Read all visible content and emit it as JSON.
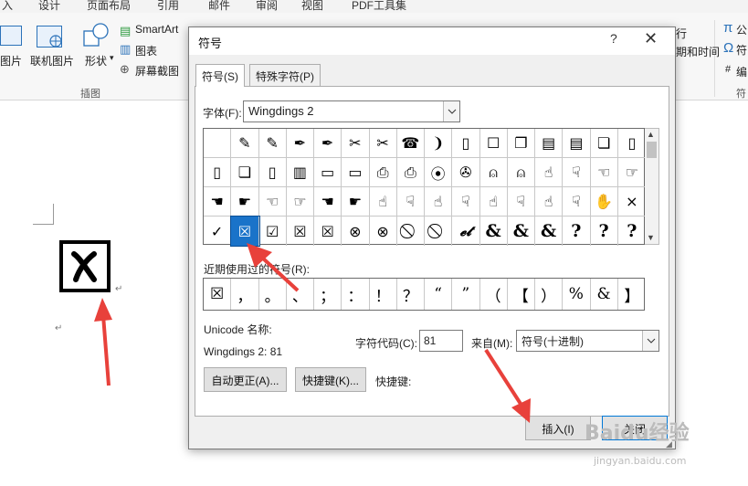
{
  "ribbon": {
    "tabs": [
      "入",
      "设计",
      "页面布局",
      "引用",
      "邮件",
      "审阅",
      "视图",
      "PDF工具集"
    ],
    "buttons": {
      "picture": "图片",
      "online_picture": "联机图片",
      "shapes": "形状",
      "smartart": "SmartArt",
      "chart": "图表",
      "screenshot": "屏幕截图",
      "group_illustrations": "插图",
      "right_row": "行",
      "right_time": "期和时间",
      "right_pi": "公",
      "right_omega": "符",
      "right_bian": "编",
      "right_fu": "符"
    }
  },
  "dialog": {
    "title": "符号",
    "help": "?",
    "close": "✕",
    "tabs": {
      "symbols": "符号(S)",
      "special": "特殊字符(P)"
    },
    "font_label": "字体(F):",
    "font_value": "Wingdings 2",
    "symbol_rows": [
      [
        " ",
        "✎",
        "✎",
        "✒",
        "✒",
        "✂",
        "✂",
        "☎",
        "❩",
        "▯",
        "☐",
        "❐",
        "▤",
        "▤",
        "❏",
        "▯"
      ],
      [
        "▯",
        "❏",
        "▯",
        "▥",
        "▭",
        "▭",
        "⎙",
        "⎙",
        "⦿",
        "✇",
        "⍝",
        "⍝",
        "☝",
        "☟",
        "☜",
        "☞"
      ],
      [
        "☚",
        "☛",
        "☜",
        "☞",
        "☚",
        "☛",
        "☝",
        "☟",
        "☝",
        "☟",
        "☝",
        "☟",
        "☝",
        "☟",
        "✋",
        "×"
      ],
      [
        "✓",
        "☒",
        "☑",
        "☒",
        "☒",
        "⊗",
        "⊗",
        "⃠",
        "⃠",
        "𝓮𝓽",
        "&",
        "&",
        "&",
        "?",
        "?",
        "?"
      ]
    ],
    "selected_cell": "☒",
    "recent_label": "近期使用过的符号(R):",
    "recent": [
      "☒",
      "，",
      "。",
      "、",
      "；",
      "：",
      "！",
      "？",
      "“",
      "”",
      "（",
      "【",
      "）",
      "%",
      "&",
      "】"
    ],
    "unicode_name_label": "Unicode 名称:",
    "unicode_name_value": "Wingdings 2: 81",
    "char_code_label": "字符代码(C):",
    "char_code_value": "81",
    "from_label": "来自(M):",
    "from_value": "符号(十进制)",
    "autocorrect_btn": "自动更正(A)...",
    "shortcut_btn": "快捷键(K)...",
    "shortcut_label": "快捷键:",
    "insert_btn": "插入(I)",
    "close_btn": "关闭"
  },
  "document": {
    "box_symbol": "☒",
    "para_marks": [
      "↵",
      "↵"
    ]
  },
  "watermark": {
    "brand": "Baidu经验",
    "url": "jingyan.baidu.com"
  },
  "colors": {
    "accent": "#1a73c9",
    "arrow": "#e8413b"
  }
}
